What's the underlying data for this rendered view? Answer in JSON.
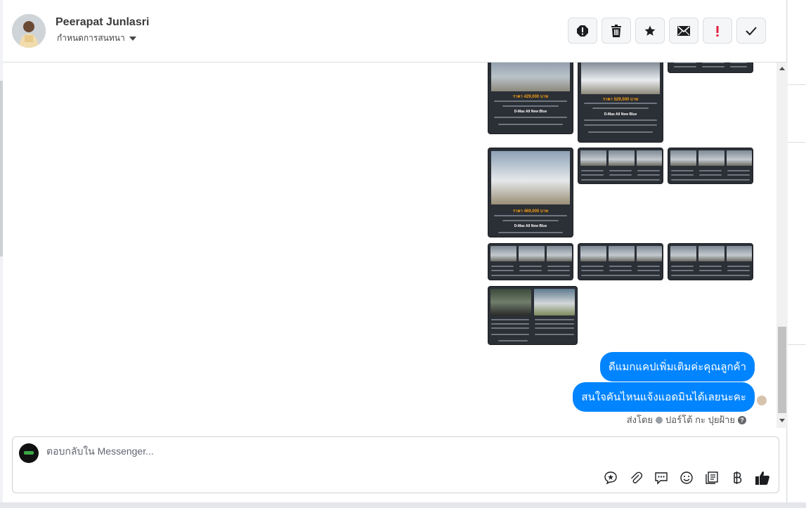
{
  "contact": {
    "name": "Peerapat Junlasri",
    "assign_label": "กำหนดการสนทนา"
  },
  "header_actions": [
    {
      "name": "spam-icon"
    },
    {
      "name": "trash-icon"
    },
    {
      "name": "star-icon"
    },
    {
      "name": "mail-icon"
    },
    {
      "name": "exclamation-icon"
    },
    {
      "name": "check-icon"
    }
  ],
  "thread": {
    "car_cards": [
      {
        "price": "ราคา 429,000 บาท",
        "model": "D-Max All New Blue"
      },
      {
        "price": "ราคา 529,000 บาท",
        "model": "D-Max All New Blue"
      },
      {
        "price": "ราคา 469,000 บาท",
        "model": "D-Max All New Blue"
      }
    ],
    "messages": [
      "ดีแมกแคปเพิ่มเติมค่ะคุณลูกค้า",
      "สนใจคันไหนแจ้งแอดมินได้เลยนะคะ"
    ],
    "sent_by_prefix": "ส่งโดย",
    "sent_by_name": "ปอร์โต้ กะ ปุยฝ้าย"
  },
  "composer": {
    "placeholder": "ตอบกลับใน Messenger...",
    "tools": [
      "saved-reply-icon",
      "attachment-icon",
      "chat-icon",
      "emoji-icon",
      "notes-icon",
      "baht-icon",
      "like-icon"
    ]
  },
  "colors": {
    "bubble": "#0084ff",
    "accent_red": "#e41e3f"
  }
}
